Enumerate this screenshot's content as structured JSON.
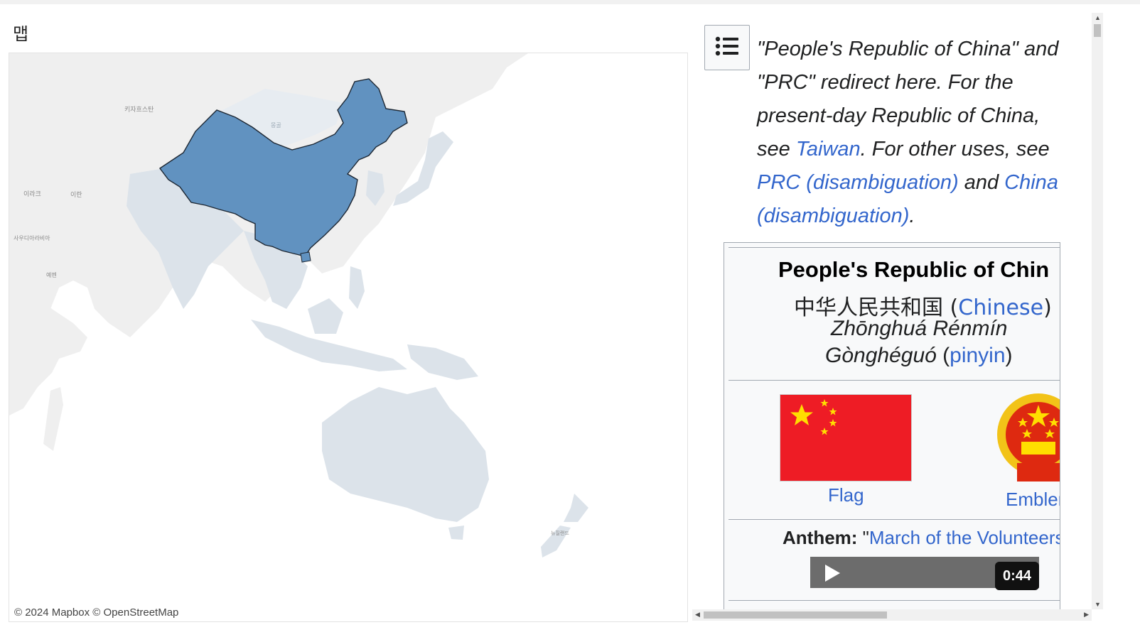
{
  "page": {
    "title": "맵"
  },
  "map": {
    "attribution": "© 2024 Mapbox © OpenStreetMap",
    "labels": [
      "키자흐스탄",
      "몽골",
      "이라크",
      "이란",
      "사우디아라비아",
      "예멘",
      "뉴질랜드"
    ],
    "highlight_color": "#6192c0",
    "region_color": "#dce3ea",
    "base_color": "#efefef"
  },
  "toc_button": {
    "icon": "list-icon"
  },
  "hatnote": {
    "part1": "\"People's Republic of China\" and \"PRC\" redirect here. For the present-day Republic of China, see ",
    "link1": "Taiwan",
    "part2": ". For other uses, see ",
    "link2": "PRC (disambiguation)",
    "part3": " and ",
    "link3": "China (disambiguation)",
    "part4": "."
  },
  "infobox": {
    "title": "People's Republic of Chin",
    "native_name": "中华人民共和国 (",
    "native_lang": "Chinese",
    "native_close": ")",
    "romanized_1": "Zhōnghuá Rénmín",
    "romanized_2": "Gònghéguó",
    "pinyin_open": " (",
    "pinyin_link": "pinyin",
    "pinyin_close": ")",
    "flag_caption": "Flag",
    "emblem_caption": "Embler",
    "anthem_label": "Anthem:",
    "anthem_quote": " \"",
    "anthem_link": "March of the Volunteers",
    "audio_time": "0:44"
  }
}
